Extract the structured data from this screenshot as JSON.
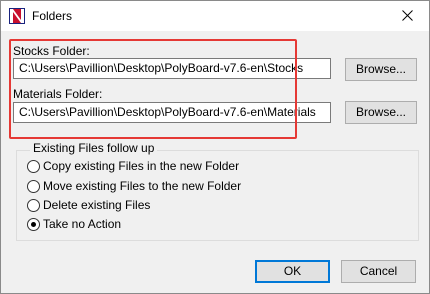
{
  "window": {
    "title": "Folders"
  },
  "stocks": {
    "label": "Stocks Folder:",
    "value": "C:\\Users\\Pavillion\\Desktop\\PolyBoard-v7.6-en\\Stocks",
    "browse_label": "Browse..."
  },
  "materials": {
    "label": "Materials Folder:",
    "value": "C:\\Users\\Pavillion\\Desktop\\PolyBoard-v7.6-en\\Materials",
    "browse_label": "Browse..."
  },
  "existing_files": {
    "title": "Existing Files follow up",
    "options": [
      {
        "label": "Copy existing Files in the new Folder",
        "checked": false
      },
      {
        "label": "Move existing Files to the new Folder",
        "checked": false
      },
      {
        "label": "Delete existing Files",
        "checked": false
      },
      {
        "label": "Take no Action",
        "checked": true
      }
    ]
  },
  "footer": {
    "ok_label": "OK",
    "cancel_label": "Cancel"
  },
  "colors": {
    "highlight": "#e53935",
    "accent": "#0078d7",
    "app_icon_red": "#c8102e",
    "app_icon_blue": "#1a237e"
  },
  "icons": {
    "app": "polyboard-app-icon",
    "close": "close-icon"
  }
}
